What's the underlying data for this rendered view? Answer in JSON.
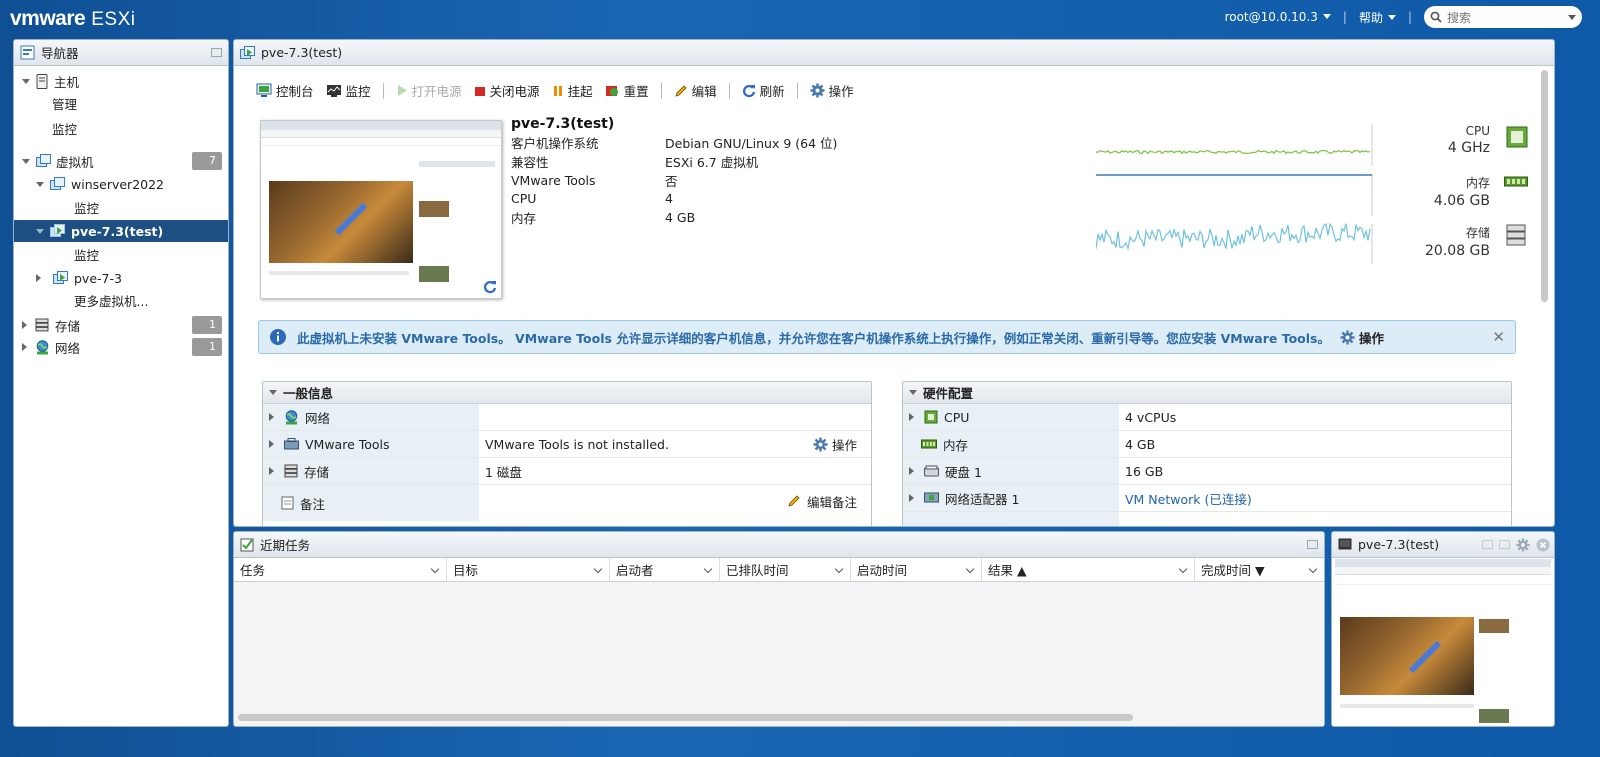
{
  "topbar": {
    "brand": "vmware",
    "product": "ESXi",
    "user": "root@10.0.10.3",
    "help": "帮助",
    "search_placeholder": "搜索"
  },
  "navigator": {
    "title": "导航器",
    "host": {
      "label": "主机",
      "children": [
        "管理",
        "监控"
      ]
    },
    "vms": {
      "label": "虚拟机",
      "count": "7"
    },
    "winserver": {
      "label": "winserver2022",
      "child": "监控"
    },
    "pve_test": {
      "label": "pve-7.3(test)",
      "child": "监控"
    },
    "pve": {
      "label": "pve-7-3"
    },
    "more_vms": "更多虚拟机...",
    "storage": {
      "label": "存储",
      "count": "1"
    },
    "network": {
      "label": "网络",
      "count": "1"
    }
  },
  "main": {
    "title": "pve-7.3(test)",
    "toolbar": {
      "console": "控制台",
      "monitor": "监控",
      "power_on": "打开电源",
      "power_off": "关闭电源",
      "suspend": "挂起",
      "reset": "重置",
      "edit": "编辑",
      "refresh": "刷新",
      "actions": "操作"
    },
    "summary": {
      "vm_name": "pve-7.3(test)",
      "rows": [
        {
          "k": "客户机操作系统",
          "v": "Debian GNU/Linux 9 (64 位)"
        },
        {
          "k": "兼容性",
          "v": "ESXi 6.7 虚拟机"
        },
        {
          "k": "VMware Tools",
          "v": "否"
        },
        {
          "k": "CPU",
          "v": "4"
        },
        {
          "k": "内存",
          "v": "4 GB"
        }
      ]
    },
    "metrics": {
      "cpu_label": "CPU",
      "cpu_value": "4 GHz",
      "mem_label": "内存",
      "mem_value": "4.06 GB",
      "storage_label": "存储",
      "storage_value": "20.08 GB"
    },
    "banner": {
      "text": "此虚拟机上未安装 VMware Tools。 VMware Tools 允许显示详细的客户机信息，并允许您在客户机操作系统上执行操作，例如正常关闭、重新引导等。您应安装 VMware Tools。",
      "action": "操作"
    },
    "general": {
      "title": "一般信息",
      "network": "网络",
      "tools": "VMware Tools",
      "tools_value": "VMware Tools is not installed.",
      "tools_action": "操作",
      "storage": "存储",
      "storage_value": "1 磁盘",
      "notes": "备注",
      "edit_notes": "编辑备注"
    },
    "hardware": {
      "title": "硬件配置",
      "rows": [
        {
          "k": "CPU",
          "v": "4 vCPUs"
        },
        {
          "k": "内存",
          "v": "4 GB"
        },
        {
          "k": "硬盘 1",
          "v": "16 GB"
        },
        {
          "k": "网络适配器 1",
          "v": "VM Network (已连接)"
        }
      ]
    }
  },
  "tasks": {
    "title": "近期任务",
    "columns": [
      "任务",
      "目标",
      "启动者",
      "已排队时间",
      "启动时间",
      "结果 ▲",
      "完成时间 ▼"
    ]
  },
  "console_panel": {
    "title": "pve-7.3(test)"
  },
  "colors": {
    "accent": "#1d4f83",
    "cpu_line": "#7dc242",
    "mem_line": "#3c7cb8",
    "storage_line": "#6fc2e0"
  }
}
